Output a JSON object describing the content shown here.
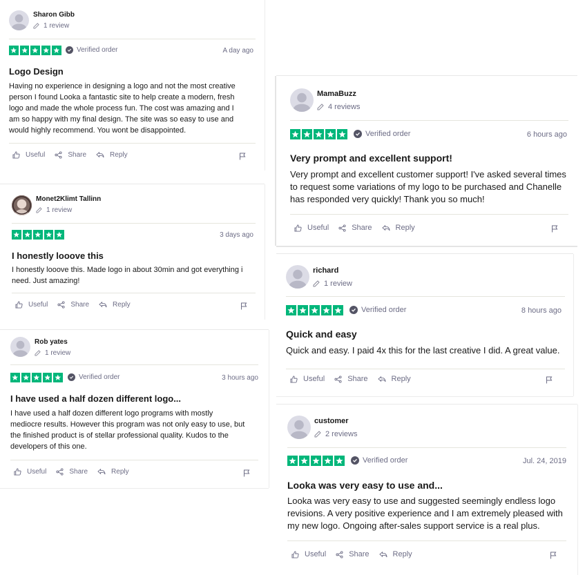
{
  "colors": {
    "star_green": "#00b67a",
    "muted": "#6c6c85",
    "divider": "#e5e5dd"
  },
  "icons": {
    "avatar": "default-avatar-icon",
    "review": "pencil-icon",
    "verified": "check-circle-icon",
    "useful": "thumbs-up-icon",
    "share": "share-icon",
    "reply": "reply-icon",
    "report": "flag-icon"
  },
  "actions": {
    "useful": "Useful",
    "share": "Share",
    "reply": "Reply"
  },
  "reviews": [
    {
      "author": "Sharon Gibb",
      "review_count": "1 review",
      "rating": 5,
      "verified": "Verified order",
      "date": "A day ago",
      "title": "Logo Design",
      "body_lines": [
        "Having no experience in designing a logo and not the most creative",
        "person I found Looka a fantastic site to help create a modern, fresh",
        "logo and made the whole process fun. The cost was amazing and I",
        "am so happy with my final design. The site was so easy to use and",
        "would highly recommend. You wont be disappointed."
      ]
    },
    {
      "author": "Monet2Klimt Tallinn",
      "review_count": "1 review",
      "rating": 5,
      "verified": "",
      "date": "3 days ago",
      "title": "I honestly looove this",
      "body_lines": [
        "I honestly looove this. Made logo in about 30min and got everything i",
        "need. Just amazing!"
      ]
    },
    {
      "author": "Rob yates",
      "review_count": "1 review",
      "rating": 5,
      "verified": "Verified order",
      "date": "3 hours ago",
      "title": "I have used a half dozen different logo...",
      "body_lines": [
        "I have used a half dozen different logo programs with mostly",
        "mediocre results. However this program was not only easy to use, but",
        "the finished product is of stellar professional quality. Kudos to the",
        "developers of this one."
      ]
    },
    {
      "author": "MamaBuzz",
      "review_count": "4 reviews",
      "rating": 5,
      "verified": "Verified order",
      "date": "6 hours ago",
      "title": "Very prompt and excellent support!",
      "body_lines": [
        "Very prompt and excellent customer support! I've asked several times",
        "to request some variations of my logo to be purchased and Chanelle",
        "has responded very quickly! Thank you so much!"
      ]
    },
    {
      "author": "richard",
      "review_count": "1 review",
      "rating": 5,
      "verified": "Verified order",
      "date": "8 hours ago",
      "title": "Quick and easy",
      "body_lines": [
        "Quick and easy. I paid 4x this for the last creative I did. A great value."
      ]
    },
    {
      "author": "customer",
      "review_count": "2 reviews",
      "rating": 5,
      "verified": "Verified order",
      "date": "Jul. 24, 2019",
      "title": "Looka was very easy to use and...",
      "body_lines": [
        "Looka was very easy to use and suggested seemingly endless logo",
        "revisions. A very positive experience and I am extremely pleased with",
        "my new logo. Ongoing after-sales support service is a real plus."
      ]
    }
  ]
}
